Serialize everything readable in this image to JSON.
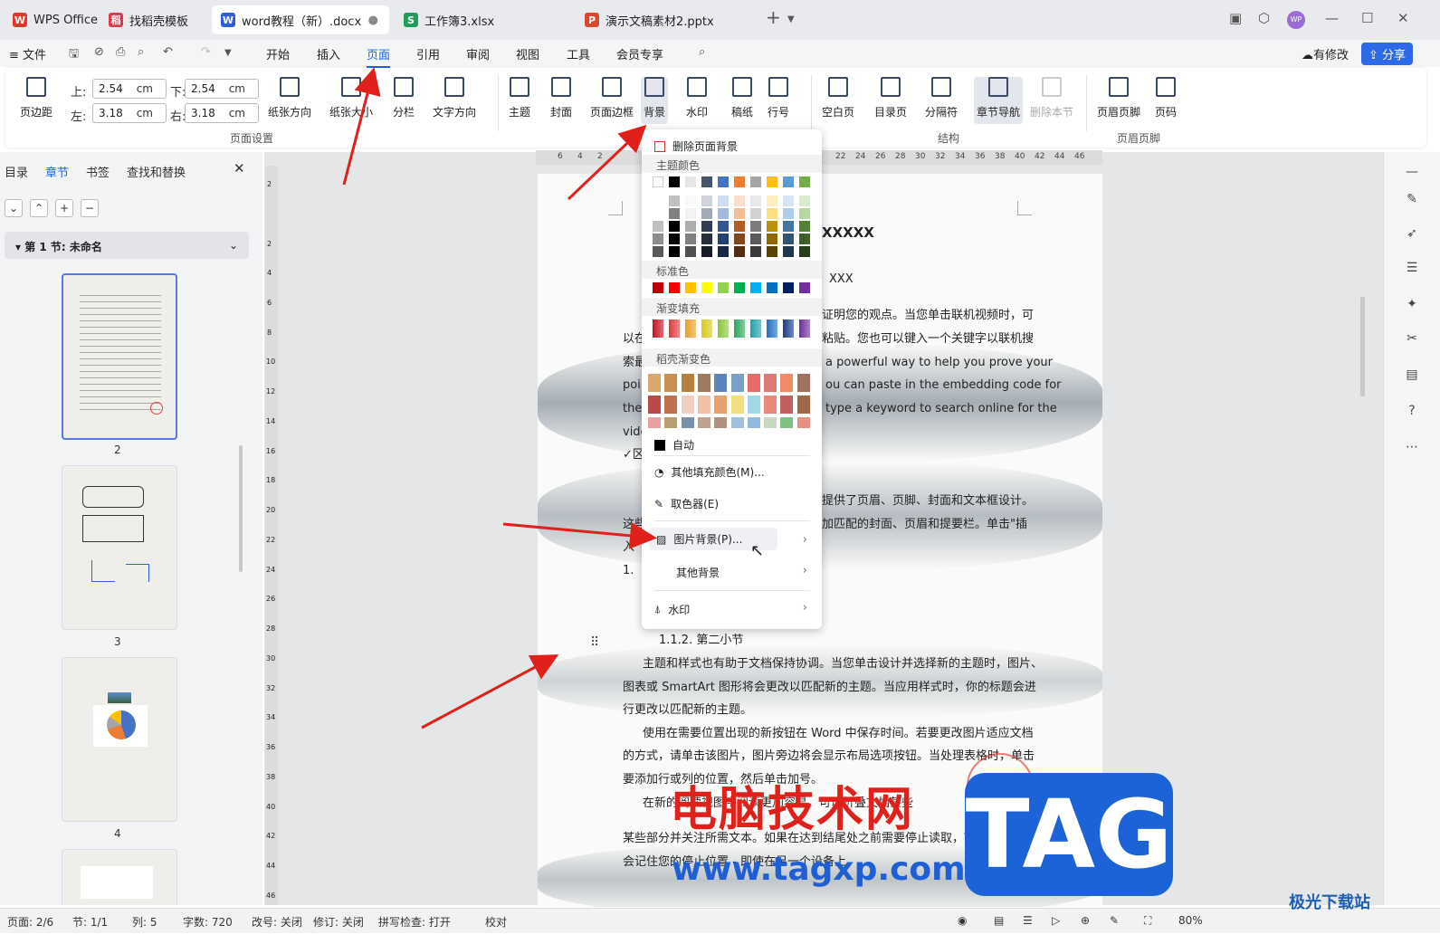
{
  "tabs": [
    {
      "label": "WPS Office",
      "icon": "W",
      "color": "#d83b2b"
    },
    {
      "label": "找稻壳模板",
      "icon": "稻",
      "color": "#d83b4b"
    },
    {
      "label": "word教程（新）.docx",
      "icon": "W",
      "color": "#2f5fd8"
    },
    {
      "label": "工作簿3.xlsx",
      "icon": "S",
      "color": "#1e9e5a"
    },
    {
      "label": "演示文稿素材2.pptx",
      "icon": "P",
      "color": "#d8482b"
    }
  ],
  "window": {
    "new_tab": "+",
    "minimize": "—",
    "maximize": "☐",
    "close": "✕",
    "avatar": "WP"
  },
  "menu": {
    "file": "文件",
    "items": [
      "开始",
      "插入",
      "页面",
      "引用",
      "审阅",
      "视图",
      "工具",
      "会员专享"
    ],
    "revise": "有修改",
    "share": "分享"
  },
  "ribbon": {
    "margins": {
      "button": "页边距",
      "top_label": "上:",
      "top": "2.54",
      "bottom_label": "下:",
      "bottom": "2.54",
      "left_label": "左:",
      "left": "3.18",
      "right_label": "右:",
      "right": "3.18",
      "unit": "cm"
    },
    "page_setup": [
      "纸张方向",
      "纸张大小",
      "分栏",
      "文字方向"
    ],
    "style": [
      "主题",
      "封面",
      "页面边框",
      "背景",
      "水印",
      "稿纸",
      "行号"
    ],
    "structure": [
      "空白页",
      "目录页",
      "分隔符",
      "章节导航",
      "删除本节"
    ],
    "header_footer": [
      "页眉页脚",
      "页码"
    ],
    "groups": {
      "page_setup": "页面设置",
      "structure": "结构",
      "header_footer": "页眉页脚"
    }
  },
  "left": {
    "tabs": [
      "目录",
      "章节",
      "书签",
      "查找和替换"
    ],
    "close": "✕",
    "section": "第 1 节: 未命名",
    "pages": [
      "2",
      "3",
      "4"
    ]
  },
  "ruler": {
    "ticks": [
      "6",
      "4",
      "2",
      "22",
      "24",
      "26",
      "28",
      "30",
      "32",
      "34",
      "36",
      "38",
      "40",
      "42",
      "44",
      "46"
    ]
  },
  "vruler": [
    "2",
    "2",
    "4",
    "6",
    "8",
    "10",
    "12",
    "14",
    "16",
    "18",
    "20",
    "22",
    "24",
    "26",
    "28",
    "30",
    "32",
    "34",
    "36",
    "38",
    "40",
    "42",
    "44",
    "46"
  ],
  "doc": {
    "title_tail": "XXXXX",
    "sub_tail": "XXX",
    "p1": "证明您的观点。当您单击联机视频时，可",
    "p2a": "以在",
    "p2b": "粘贴。您也可以键入一个关键字以联机搜",
    "p3a": "索最",
    "p3b": "a powerful way to help you prove your",
    "p4a": "poin",
    "p4b": "ou can paste in the embedding code for",
    "p5a": "the",
    "p5b": "type a keyword to search online for the",
    "p6": "vide",
    "p7": "✓区",
    "p8": "提供了页眉、页脚、封面和文本框设计。",
    "p9a": "这些",
    "p9b": "加匹配的封面、页眉和提要栏。单击\"插",
    "p10": "入\"",
    "p11": "1.",
    "heading": "1.1.2.   第二小节",
    "b1": "主题和样式也有助于文档保持协调。当您单击设计并选择新的主题时，图片、",
    "b2": "图表或 SmartArt 图形将会更改以匹配新的主题。当应用样式时，你的标题会进",
    "b3": "行更改以匹配新的主题。",
    "b4": "使用在需要位置出现的新按钮在 Word 中保存时间。若要更改图片适应文档",
    "b5": "的方式，请单击该图片，图片旁边将会显示布局选项按钮。当处理表格时，单击",
    "b6": "要添加行或列的位置，然后单击加号。",
    "b7": "在新的阅读视图中阅读更加容易。可以折叠文档某些",
    "b8": "某些部分并关注所需文本。如果在达到结尾处之前需要停止读取，Word",
    "b9": "会记住您的停止位置 - 即使在另一个设备上。"
  },
  "popup": {
    "remove": "删除页面背景",
    "theme_colors": "主题颜色",
    "standard": "标准色",
    "gradient": "渐变填充",
    "docer_gradient": "稻壳渐变色",
    "auto": "自动",
    "more_fill": "其他填充颜色(M)...",
    "eyedropper": "取色器(E)",
    "picture_bg": "图片背景(P)...",
    "other_bg": "其他背景",
    "watermark": "水印",
    "theme_row": [
      "#ffffff",
      "#000000",
      "#e7e6e6",
      "#44546a",
      "#4472c4",
      "#ed7d31",
      "#a5a5a5",
      "#ffc000",
      "#5b9bd5",
      "#70ad47"
    ],
    "standard_row": [
      "#c00000",
      "#ff0000",
      "#ffc000",
      "#ffff00",
      "#92d050",
      "#00b050",
      "#00b0f0",
      "#0070c0",
      "#002060",
      "#7030a0"
    ],
    "gradient_row": [
      "#c0141c",
      "#e03a3a",
      "#e8a020",
      "#d8c820",
      "#8cc43c",
      "#2aa85a",
      "#20a0a8",
      "#1f6fc4",
      "#1a3c8c",
      "#6c2ea0"
    ]
  },
  "status": {
    "page": "页面: 2/6",
    "section": "节: 1/1",
    "col": "列: 5",
    "words": "字数: 720",
    "revise": "改号: 关闭",
    "track": "修订: 关闭",
    "spell": "拼写检查: 打开",
    "proof": "校对",
    "zoom": "80%"
  },
  "watermark": {
    "title": "电脑技术网",
    "url": "www.tagxp.com",
    "tag": "TAG",
    "site": "极光下载站"
  }
}
